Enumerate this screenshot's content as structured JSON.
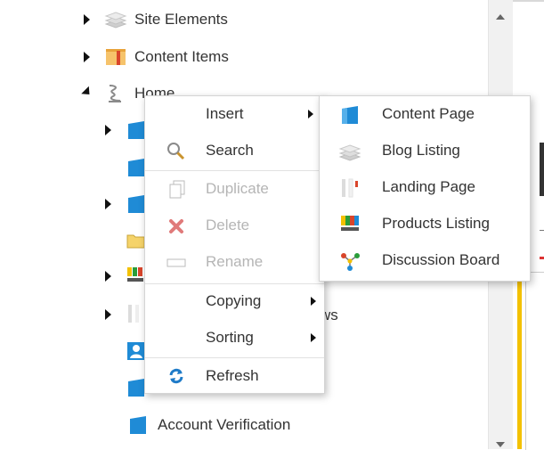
{
  "tree": {
    "items": [
      {
        "label": "Site Elements",
        "icon": "layers-icon"
      },
      {
        "label": "Content Items",
        "icon": "content-items-icon"
      },
      {
        "label": "Home",
        "icon": "home-tree-icon"
      },
      {
        "label": "ws",
        "icon": "page-icon"
      },
      {
        "label": "Account Verification",
        "icon": "page-icon"
      }
    ]
  },
  "context_menu": {
    "items": [
      {
        "label": "Insert",
        "icon": "",
        "disabled": false,
        "has_submenu": true
      },
      {
        "label": "Search",
        "icon": "search-icon",
        "disabled": false,
        "has_submenu": false
      },
      {
        "label": "Duplicate",
        "icon": "duplicate-icon",
        "disabled": true,
        "has_submenu": false
      },
      {
        "label": "Delete",
        "icon": "delete-icon",
        "disabled": true,
        "has_submenu": false
      },
      {
        "label": "Rename",
        "icon": "rename-icon",
        "disabled": true,
        "has_submenu": false
      },
      {
        "label": "Copying",
        "icon": "",
        "disabled": false,
        "has_submenu": true
      },
      {
        "label": "Sorting",
        "icon": "",
        "disabled": false,
        "has_submenu": true
      },
      {
        "label": "Refresh",
        "icon": "refresh-icon",
        "disabled": false,
        "has_submenu": false
      }
    ]
  },
  "insert_submenu": {
    "items": [
      {
        "label": "Content Page",
        "icon": "content-page-icon"
      },
      {
        "label": "Blog Listing",
        "icon": "blog-listing-icon"
      },
      {
        "label": "Landing Page",
        "icon": "landing-page-icon"
      },
      {
        "label": "Products Listing",
        "icon": "products-listing-icon"
      },
      {
        "label": "Discussion Board",
        "icon": "discussion-board-icon"
      }
    ]
  },
  "colors": {
    "page_blue": "#1f8bd6",
    "accent_yellow": "#f3c100",
    "delete_red": "#e05a5a",
    "disabled_text": "#b5b5b5"
  }
}
